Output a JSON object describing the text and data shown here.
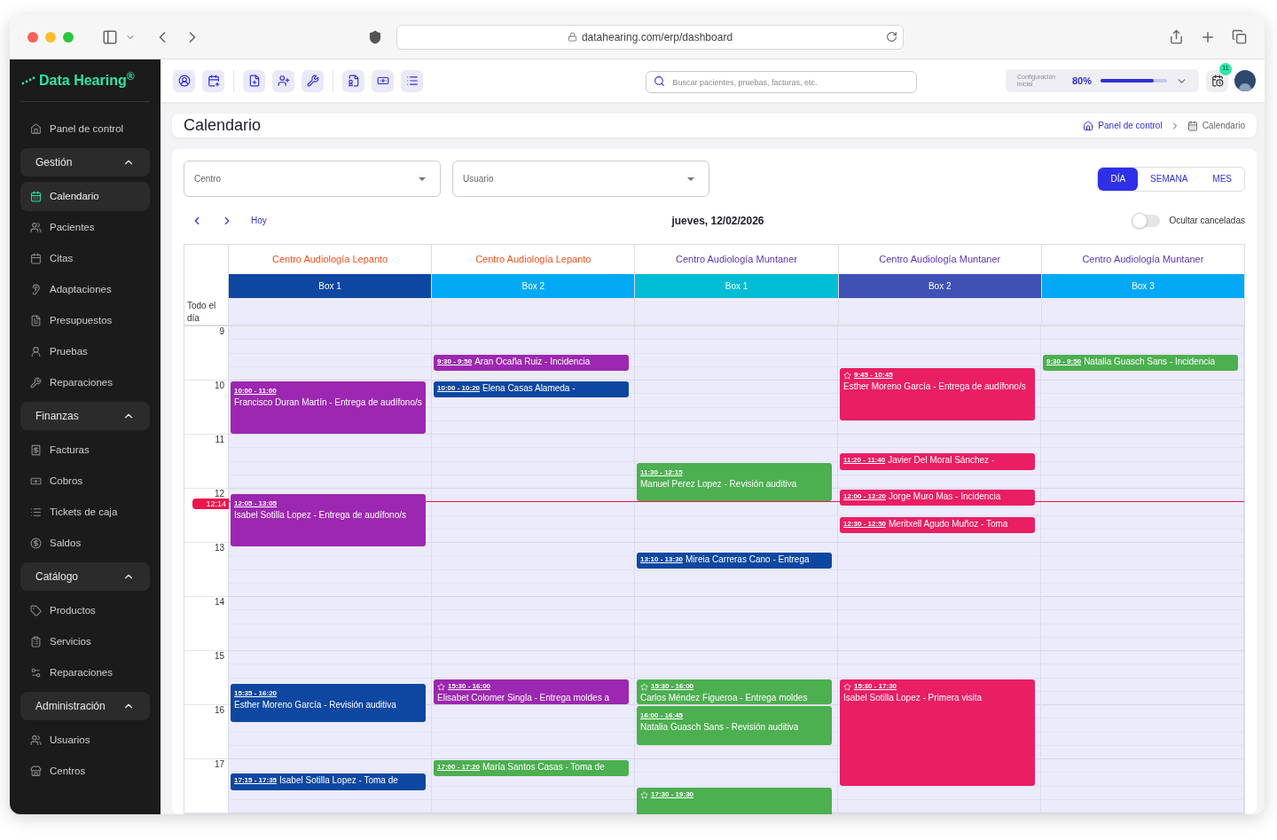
{
  "browser": {
    "url": "datahearing.com/erp/dashboard"
  },
  "sidebar": {
    "logo": "Data Hearing$^{®}$",
    "top_item": {
      "label": "Panel de control",
      "selected": false
    },
    "sections": [
      {
        "title": "Gestión",
        "expanded": true,
        "items": [
          {
            "label": "Calendario",
            "selected": true
          },
          {
            "label": "Pacientes",
            "selected": false
          },
          {
            "label": "Citas",
            "selected": false
          },
          {
            "label": "Adaptaciones",
            "selected": false
          },
          {
            "label": "Presupuestos",
            "selected": false
          },
          {
            "label": "Pruebas",
            "selected": false
          },
          {
            "label": "Reparaciones",
            "selected": false
          }
        ]
      },
      {
        "title": "Finanzas",
        "expanded": true,
        "items": [
          {
            "label": "Facturas",
            "selected": false
          },
          {
            "label": "Cobros",
            "selected": false
          },
          {
            "label": "Tickets de caja",
            "selected": false
          },
          {
            "label": "Saldos",
            "selected": false
          }
        ]
      },
      {
        "title": "Catálogo",
        "expanded": true,
        "items": [
          {
            "label": "Productos",
            "selected": false
          },
          {
            "label": "Servicios",
            "selected": false
          },
          {
            "label": "Reparaciones",
            "selected": false
          }
        ]
      },
      {
        "title": "Administración",
        "expanded": true,
        "items": [
          {
            "label": "Usuarios",
            "selected": false
          },
          {
            "label": "Centros",
            "selected": false
          }
        ]
      }
    ]
  },
  "topbar": {
    "search": {
      "placeholder": "Buscar pacientes, pruebas, facturas, etc."
    },
    "setup": {
      "label": "Configuración inicial",
      "reading": "80%",
      "level": 0.8
    },
    "notifications": "11"
  },
  "page": {
    "title": "Calendario",
    "breadcrumb": [
      {
        "label": "Panel de control"
      },
      {
        "label": "Calendario"
      }
    ]
  },
  "filters": [
    {
      "placeholder": "Centro"
    },
    {
      "placeholder": "Usuario"
    }
  ],
  "views": [
    {
      "label": "DÍA",
      "selected": true
    },
    {
      "label": "SEMANA",
      "selected": false
    },
    {
      "label": "MES",
      "selected": false
    }
  ],
  "nav": {
    "today": "Hoy",
    "date": "jueves, 12/02/2026",
    "hide_cancelled": {
      "label": "Ocultar canceladas",
      "on": false
    }
  },
  "calendar": {
    "all_day": "Todo el día",
    "now": "12:14",
    "hours": [
      "9",
      "10",
      "11",
      "12",
      "13",
      "14",
      "15",
      "16",
      "17"
    ],
    "columns": [
      {
        "center": {
          "name": "Centro Audiología Lepanto",
          "color": "#f4511e"
        },
        "box": {
          "name": "Box 1",
          "color": "#0d47a1"
        },
        "events": [
          {
            "time": "10:00 - 11:00",
            "title": "Francisco Duran Martín - Entrega de audífono/s",
            "color": "#9c27b0",
            "starred": false
          },
          {
            "time": "12:05 - 13:05",
            "title": "Isabel Sotilla Lopez - Entrega de audífono/s",
            "color": "#9c27b0",
            "starred": false
          },
          {
            "time": "15:35 - 16:20",
            "title": "Esther Moreno García - Revisión auditiva",
            "color": "#0d47a1",
            "starred": false
          },
          {
            "time": "17:15 - 17:35",
            "title": "Isabel Sotilla Lopez - Toma de",
            "color": "#0d47a1",
            "starred": false
          }
        ]
      },
      {
        "center": {
          "name": "Centro Audiología Lepanto",
          "color": "#f4511e"
        },
        "box": {
          "name": "Box 2",
          "color": "#03a9f4"
        },
        "events": [
          {
            "time": "9:30 - 9:50",
            "title": "Aran Ocaña Ruiz - Incidencia",
            "color": "#9c27b0",
            "starred": false
          },
          {
            "time": "10:00 - 10:20",
            "title": "Elena Casas Alameda -",
            "color": "#0d47a1",
            "starred": false
          },
          {
            "time": "15:30 - 16:00",
            "title": "Elisabet Colomer Singla - Entrega moldes a",
            "color": "#9c27b0",
            "starred": true
          },
          {
            "time": "17:00 - 17:20",
            "title": "María Santos Casas - Toma de",
            "color": "#4caf50",
            "starred": false
          }
        ]
      },
      {
        "center": {
          "name": "Centro Audiología Muntaner",
          "color": "#5e35b1"
        },
        "box": {
          "name": "Box 1",
          "color": "#00bcd4"
        },
        "events": [
          {
            "time": "11:30 - 12:15",
            "title": "Manuel Perez Lopez - Revisión auditiva",
            "color": "#4caf50",
            "starred": false
          },
          {
            "time": "13:10 - 13:30",
            "title": "Mireia Carreras Cano - Entrega",
            "color": "#0d47a1",
            "starred": false
          },
          {
            "time": "15:30 - 16:00",
            "title": "Carlos Méndez Figueroa - Entrega moldes",
            "color": "#4caf50",
            "starred": true
          },
          {
            "time": "16:00 - 16:45",
            "title": "Natalia Guasch Sans - Revisión auditiva",
            "color": "#4caf50",
            "starred": false
          },
          {
            "time": "17:30 - 19:30",
            "color": "#4caf50",
            "starred": true
          }
        ]
      },
      {
        "center": {
          "name": "Centro Audiología Muntaner",
          "color": "#5e35b1"
        },
        "box": {
          "name": "Box 2",
          "color": "#3f51b5"
        },
        "events": [
          {
            "time": "9:45 - 10:45",
            "title": "Esther Moreno García - Entrega de audífono/s",
            "color": "#e91e63",
            "starred": true
          },
          {
            "time": "11:20 - 11:40",
            "title": "Javier Del Moral Sánchez -",
            "color": "#e91e63",
            "starred": false
          },
          {
            "time": "12:00 - 12:20",
            "title": "Jorge Muro Mas - Incidencia",
            "color": "#e91e63",
            "starred": false
          },
          {
            "time": "12:30 - 12:50",
            "title": "Meritxell Agudo Muñoz - Toma",
            "color": "#e91e63",
            "starred": false
          },
          {
            "time": "15:30 - 17:30",
            "title": "Isabel Sotilla Lopez - Primera visita",
            "color": "#e91e63",
            "starred": true
          }
        ]
      },
      {
        "center": {
          "name": "Centro Audiología Muntaner",
          "color": "#5e35b1"
        },
        "box": {
          "name": "Box 3",
          "color": "#03a9f4"
        },
        "events": [
          {
            "time": "9:30 - 9:50",
            "title": "Natalia Guasch Sans - Incidencia",
            "color": "#4caf50",
            "starred": false
          }
        ]
      }
    ]
  }
}
